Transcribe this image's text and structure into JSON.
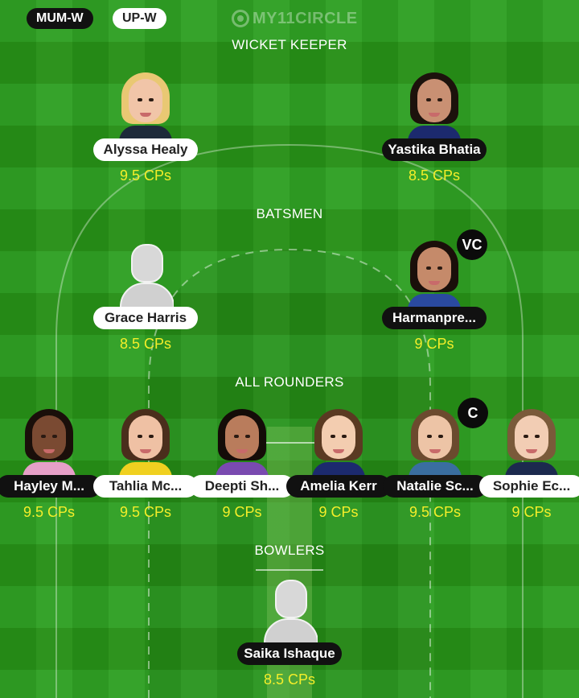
{
  "header": {
    "team_a": "MUM-W",
    "team_b": "UP-W",
    "brand": "MY11CIRCLE"
  },
  "colors": {
    "grass_light": "#2fa024",
    "grass_dark": "#279017",
    "credits": "#f4ee2a",
    "tag_dark": "#111111",
    "tag_light": "#ffffff"
  },
  "sections": {
    "wicket_keeper": "WICKET KEEPER",
    "batsmen": "BATSMEN",
    "all_rounders": "ALL ROUNDERS",
    "bowlers": "BOWLERS"
  },
  "players": {
    "wk1": {
      "name": "Alyssa Healy",
      "credits": "9.5 CPs",
      "tag": "light",
      "icon": "player-photo"
    },
    "wk2": {
      "name": "Yastika Bhatia",
      "credits": "8.5 CPs",
      "tag": "dark",
      "icon": "player-photo"
    },
    "bat1": {
      "name": "Grace Harris",
      "credits": "8.5 CPs",
      "tag": "light",
      "icon": "default-avatar-icon"
    },
    "bat2": {
      "name": "Harmanpre...",
      "credits": "9 CPs",
      "tag": "dark",
      "icon": "player-photo",
      "badge": "VC"
    },
    "ar1": {
      "name": "Hayley M...",
      "credits": "9.5 CPs",
      "tag": "dark",
      "icon": "player-photo"
    },
    "ar2": {
      "name": "Tahlia Mc...",
      "credits": "9.5 CPs",
      "tag": "light",
      "icon": "player-photo"
    },
    "ar3": {
      "name": "Deepti Sh...",
      "credits": "9 CPs",
      "tag": "light",
      "icon": "player-photo"
    },
    "ar4": {
      "name": "Amelia Kerr",
      "credits": "9 CPs",
      "tag": "dark",
      "icon": "player-photo"
    },
    "ar5": {
      "name": "Natalie Sc...",
      "credits": "9.5 CPs",
      "tag": "dark",
      "icon": "player-photo",
      "badge": "C"
    },
    "ar6": {
      "name": "Sophie Ec...",
      "credits": "9 CPs",
      "tag": "light",
      "icon": "player-photo"
    },
    "bowl1": {
      "name": "Saika Ishaque",
      "credits": "8.5 CPs",
      "tag": "dark",
      "icon": "default-avatar-icon"
    }
  }
}
